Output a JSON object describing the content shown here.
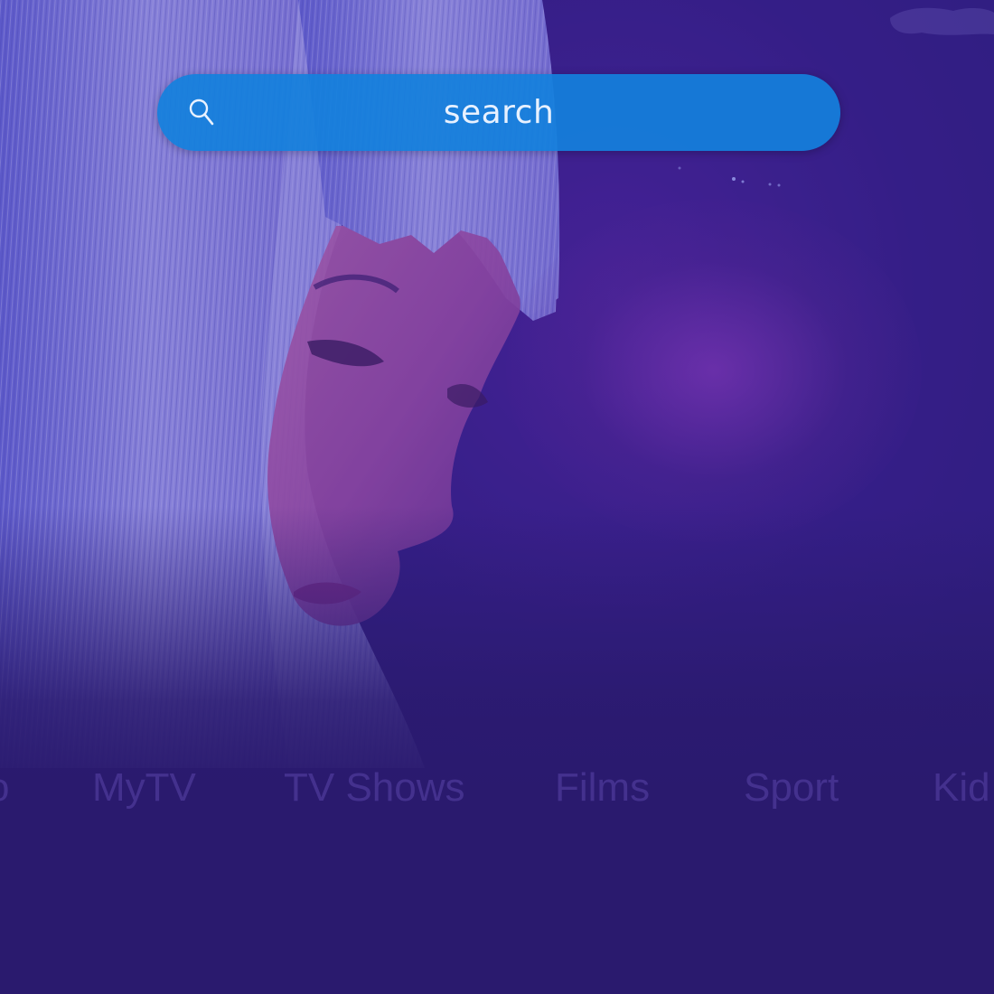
{
  "search": {
    "label": "search"
  },
  "nav": {
    "items": [
      {
        "label": "o"
      },
      {
        "label": "MyTV"
      },
      {
        "label": "TV Shows"
      },
      {
        "label": "Films"
      },
      {
        "label": "Sport"
      },
      {
        "label": "Kid"
      }
    ]
  },
  "colors": {
    "background": "#2a1a6e",
    "search_bar": "#1380dc",
    "search_text": "#e8f1ff",
    "nav_text_dim": "#5a46aa"
  },
  "icons": {
    "search": "search-icon"
  }
}
